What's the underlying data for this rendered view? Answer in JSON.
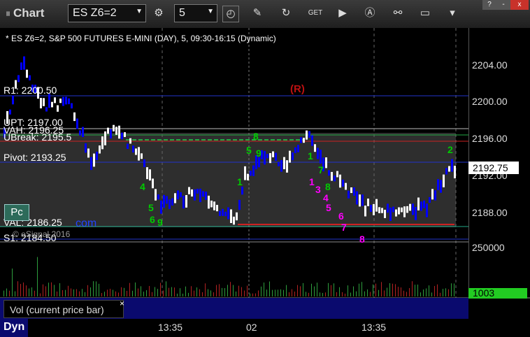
{
  "toolbar": {
    "app_title": "Chart",
    "symbol": "ES Z6=2",
    "interval": "5",
    "window_buttons": [
      "?",
      "-",
      "x"
    ]
  },
  "chart": {
    "header": "* ES Z6=2, S&P 500 FUTURES E-MINI (DAY), 5, 09:30-16:15 (Dynamic)",
    "current_price": "2192.75",
    "r_marker": "(R)",
    "pc_label": "Pc",
    "levels": [
      {
        "label": "R1: 2200.50",
        "color": "#0000ff"
      },
      {
        "label": "UPT: 2197.00",
        "color": "#ffffff"
      },
      {
        "label": "VAH: 2196.25",
        "color": "#00aa44"
      },
      {
        "label": "UBreak: 2195.5",
        "color": "#ff0000"
      },
      {
        "label": "Pivot: 2193.25",
        "color": "#0000ff"
      },
      {
        "label": "VAL: 2186.25",
        "color": "#00aa44"
      },
      {
        "label": "S1: 2184.50",
        "color": "#0000ff"
      }
    ],
    "copyright": "© eSignal 2016",
    "watermark": "com"
  },
  "price_axis": {
    "ticks": [
      "2204.00",
      "2200.00",
      "2196.00",
      "2192.00",
      "2188.00"
    ]
  },
  "volume": {
    "label": "Vol (current price bar)",
    "axis_top": "250000",
    "current": "1003"
  },
  "time_axis": {
    "dyn_label": "Dyn",
    "ticks": [
      "13:35",
      "02",
      "13:35"
    ]
  },
  "colors": {
    "up_bar": "#ffffff",
    "down_bar": "#0000ff",
    "accent_green": "#00cc00",
    "magenta": "#ff00ff"
  }
}
